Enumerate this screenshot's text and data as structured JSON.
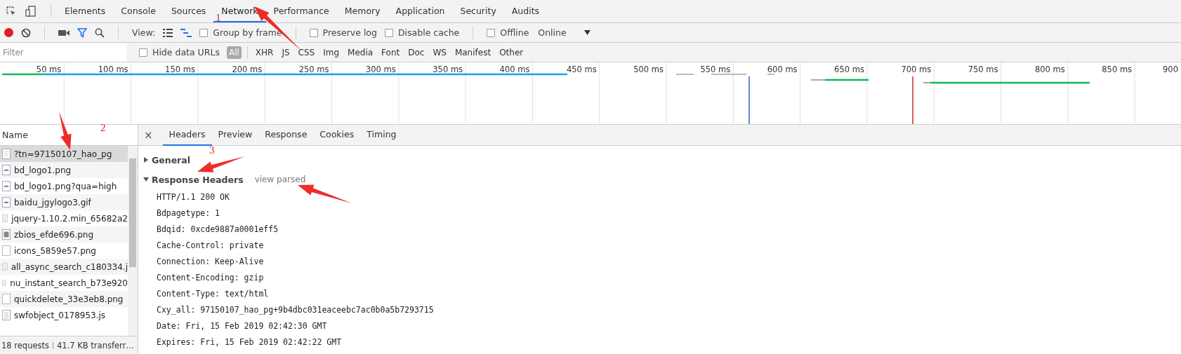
{
  "devtools_tabs": [
    {
      "label": "Elements",
      "selected": false
    },
    {
      "label": "Console",
      "selected": false
    },
    {
      "label": "Sources",
      "selected": false
    },
    {
      "label": "Network",
      "selected": true
    },
    {
      "label": "Performance",
      "selected": false
    },
    {
      "label": "Memory",
      "selected": false
    },
    {
      "label": "Application",
      "selected": false
    },
    {
      "label": "Security",
      "selected": false
    },
    {
      "label": "Audits",
      "selected": false
    }
  ],
  "toolbar": {
    "recording": true,
    "view_label": "View:",
    "options": [
      {
        "label": "Group by frame",
        "checked": false
      },
      {
        "label": "Preserve log",
        "checked": false
      },
      {
        "label": "Disable cache",
        "checked": false
      },
      {
        "label": "Offline",
        "checked": false
      }
    ],
    "throttling": "Online"
  },
  "filter_bar": {
    "placeholder": "Filter",
    "hide_data_urls": {
      "label": "Hide data URLs",
      "checked": false
    },
    "types": [
      {
        "label": "All",
        "selected": true
      },
      {
        "label": "XHR",
        "selected": false
      },
      {
        "label": "JS",
        "selected": false
      },
      {
        "label": "CSS",
        "selected": false
      },
      {
        "label": "Img",
        "selected": false
      },
      {
        "label": "Media",
        "selected": false
      },
      {
        "label": "Font",
        "selected": false
      },
      {
        "label": "Doc",
        "selected": false
      },
      {
        "label": "WS",
        "selected": false
      },
      {
        "label": "Manifest",
        "selected": false
      },
      {
        "label": "Other",
        "selected": false
      }
    ]
  },
  "timeline": {
    "ticks": [
      "50 ms",
      "100 ms",
      "150 ms",
      "200 ms",
      "250 ms",
      "300 ms",
      "350 ms",
      "400 ms",
      "450 ms",
      "500 ms",
      "550 ms",
      "600 ms",
      "650 ms",
      "700 ms",
      "750 ms",
      "800 ms",
      "850 ms",
      "900"
    ]
  },
  "requests": {
    "column": "Name",
    "rows": [
      {
        "name": "?tn=97150107_hao_pg",
        "kind": "document",
        "selected": true
      },
      {
        "name": "bd_logo1.png",
        "kind": "logo",
        "selected": false
      },
      {
        "name": "bd_logo1.png?qua=high",
        "kind": "logo",
        "selected": false
      },
      {
        "name": "baidu_jgylogo3.gif",
        "kind": "logo",
        "selected": false
      },
      {
        "name": "jquery-1.10.2.min_65682a2",
        "kind": "script",
        "selected": false
      },
      {
        "name": "zbios_efde696.png",
        "kind": "sprite",
        "selected": false
      },
      {
        "name": "icons_5859e57.png",
        "kind": "blank",
        "selected": false
      },
      {
        "name": "all_async_search_c180334.j",
        "kind": "script",
        "selected": false
      },
      {
        "name": "nu_instant_search_b73e920",
        "kind": "script",
        "selected": false
      },
      {
        "name": "quickdelete_33e3eb8.png",
        "kind": "blank",
        "selected": false
      },
      {
        "name": "swfobject_0178953.js",
        "kind": "script",
        "selected": false
      }
    ],
    "summary": "18 requests",
    "transferred": "41.7 KB transferr…"
  },
  "details": {
    "close": "×",
    "tabs": [
      {
        "label": "Headers",
        "selected": true
      },
      {
        "label": "Preview",
        "selected": false
      },
      {
        "label": "Response",
        "selected": false
      },
      {
        "label": "Cookies",
        "selected": false
      },
      {
        "label": "Timing",
        "selected": false
      }
    ],
    "sections": [
      {
        "title": "General",
        "expanded": false
      },
      {
        "title": "Response Headers",
        "expanded": true,
        "action": "view parsed",
        "lines": [
          "HTTP/1.1 200 OK",
          "Bdpagetype: 1",
          "Bdqid: 0xcde9887a0001eff5",
          "Cache-Control: private",
          "Connection: Keep-Alive",
          "Content-Encoding: gzip",
          "Content-Type: text/html",
          "Cxy_all: 97150107_hao_pg+9b4dbc031eaceebc7ac0b0a5b7293715",
          "Date: Fri, 15 Feb 2019 02:42:30 GMT",
          "Expires: Fri, 15 Feb 2019 02:42:22 GMT"
        ]
      }
    ]
  },
  "annotations": [
    {
      "label": "1"
    },
    {
      "label": "2"
    },
    {
      "label": "3"
    }
  ]
}
